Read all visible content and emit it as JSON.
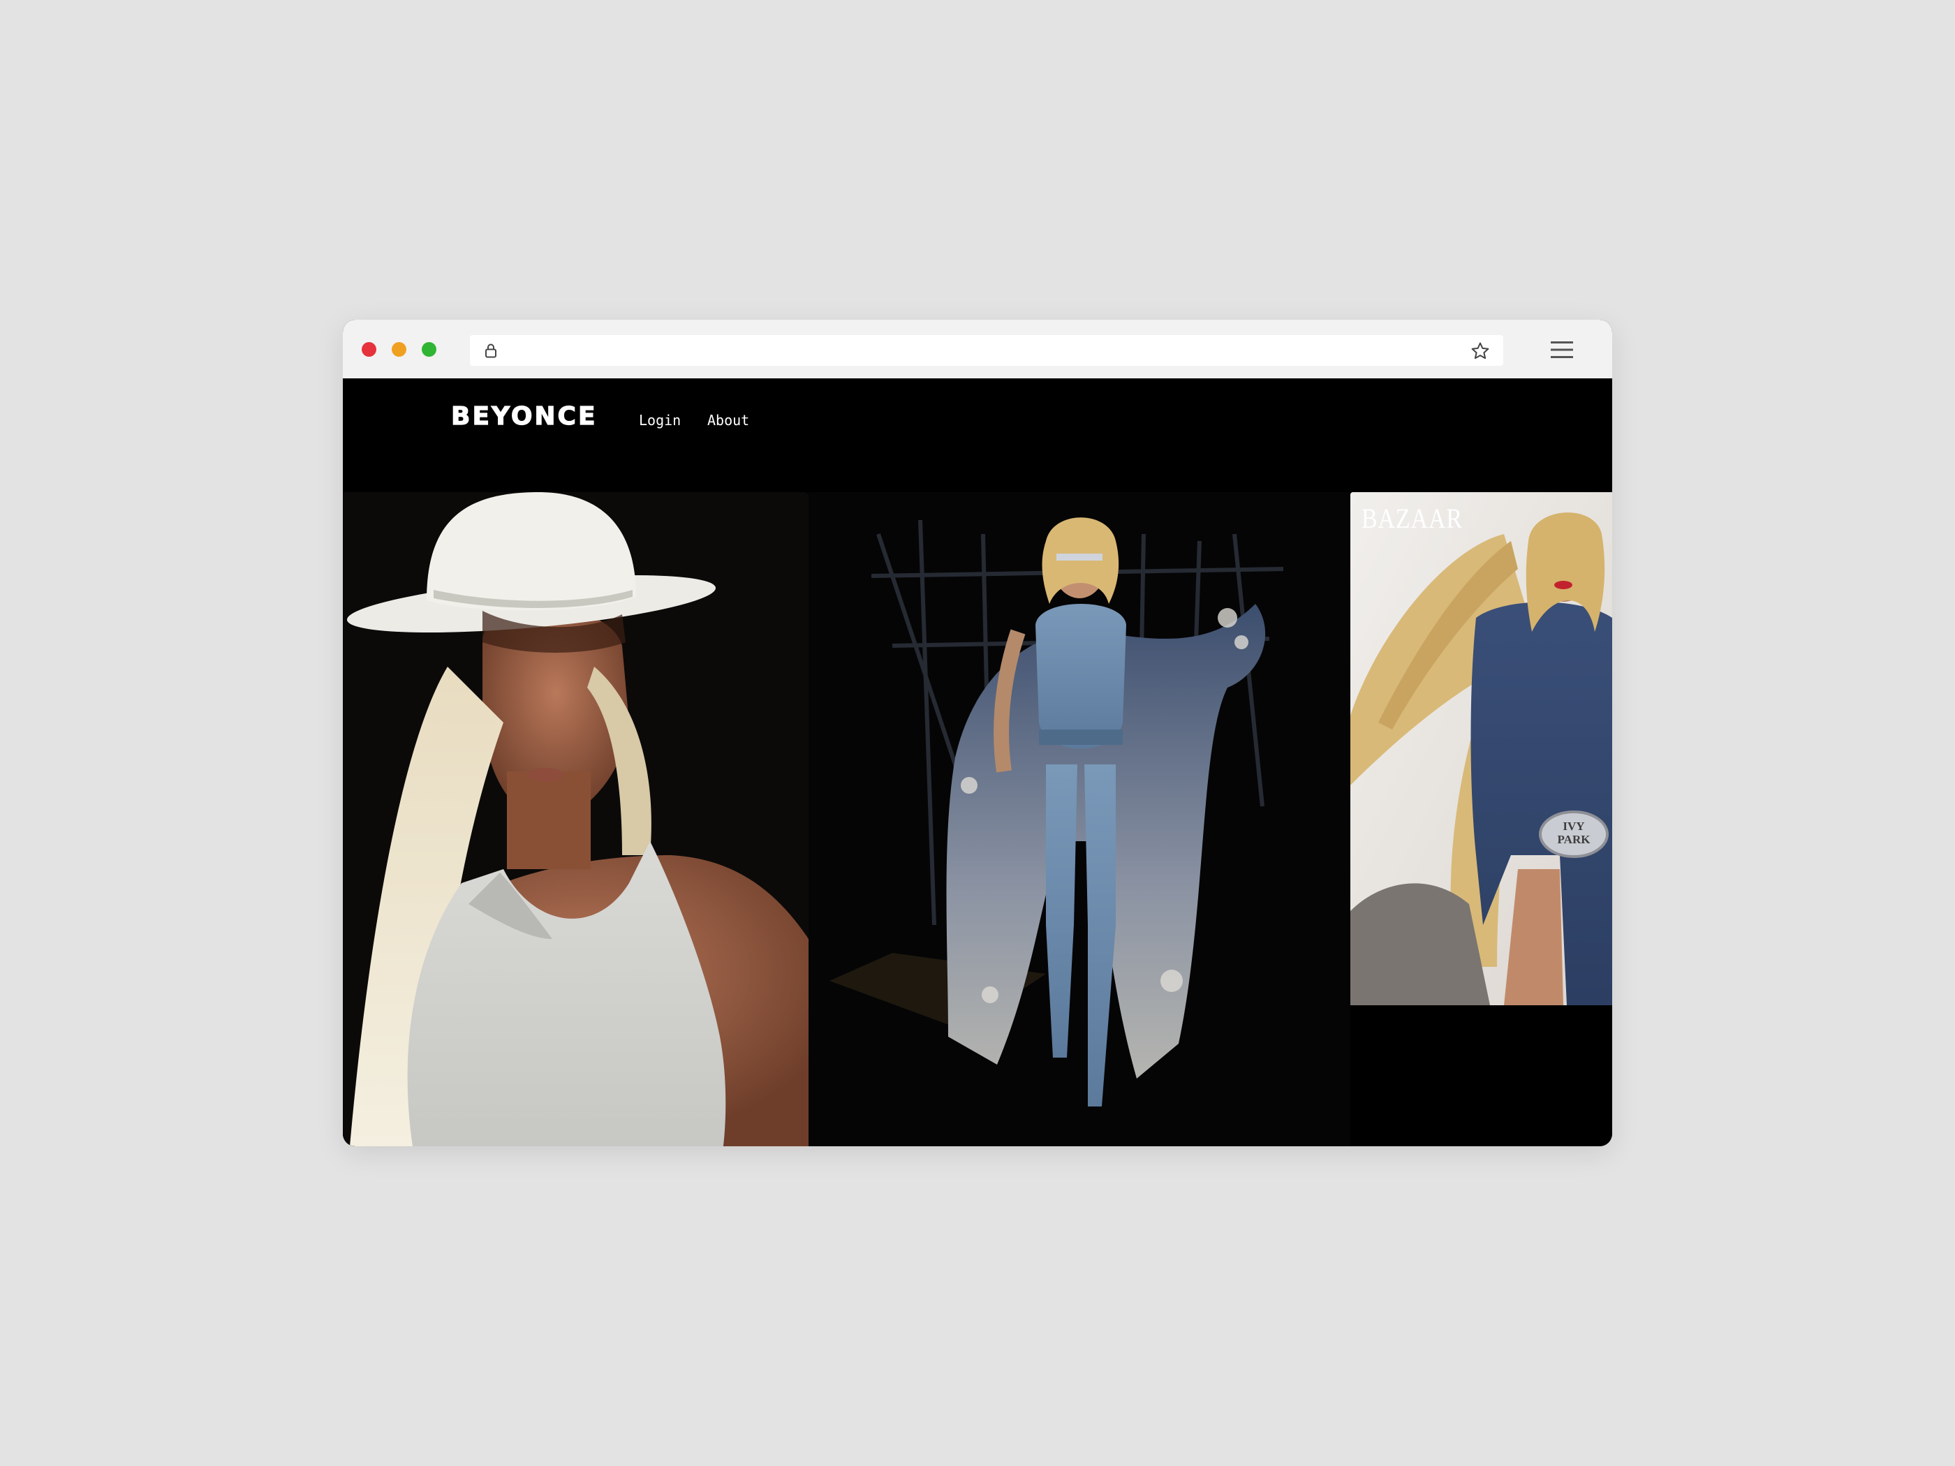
{
  "browser": {
    "window_controls": [
      "close",
      "minimize",
      "maximize"
    ],
    "url": "",
    "icons": {
      "lock": "lock-icon",
      "bookmark": "star-icon",
      "menu": "hamburger-menu-icon"
    }
  },
  "site": {
    "logo": "BEYONCE",
    "nav": [
      {
        "label": "Login"
      },
      {
        "label": "About"
      }
    ]
  },
  "gallery": [
    {
      "subject": "Woman in white cowboy hat and white tank top"
    },
    {
      "subject": "Woman in denim outfit with sparkly coat on dark stage"
    },
    {
      "subject": "Magazine cover",
      "masthead": "BAZAAR",
      "buckle_text": "IVY PARK"
    }
  ],
  "colors": {
    "page_bg": "#e3e3e3",
    "chrome_bg": "#f2f2f2",
    "site_bg": "#000000",
    "close": "#e5323c",
    "minimize": "#f0a020",
    "maximize": "#2fb533"
  }
}
